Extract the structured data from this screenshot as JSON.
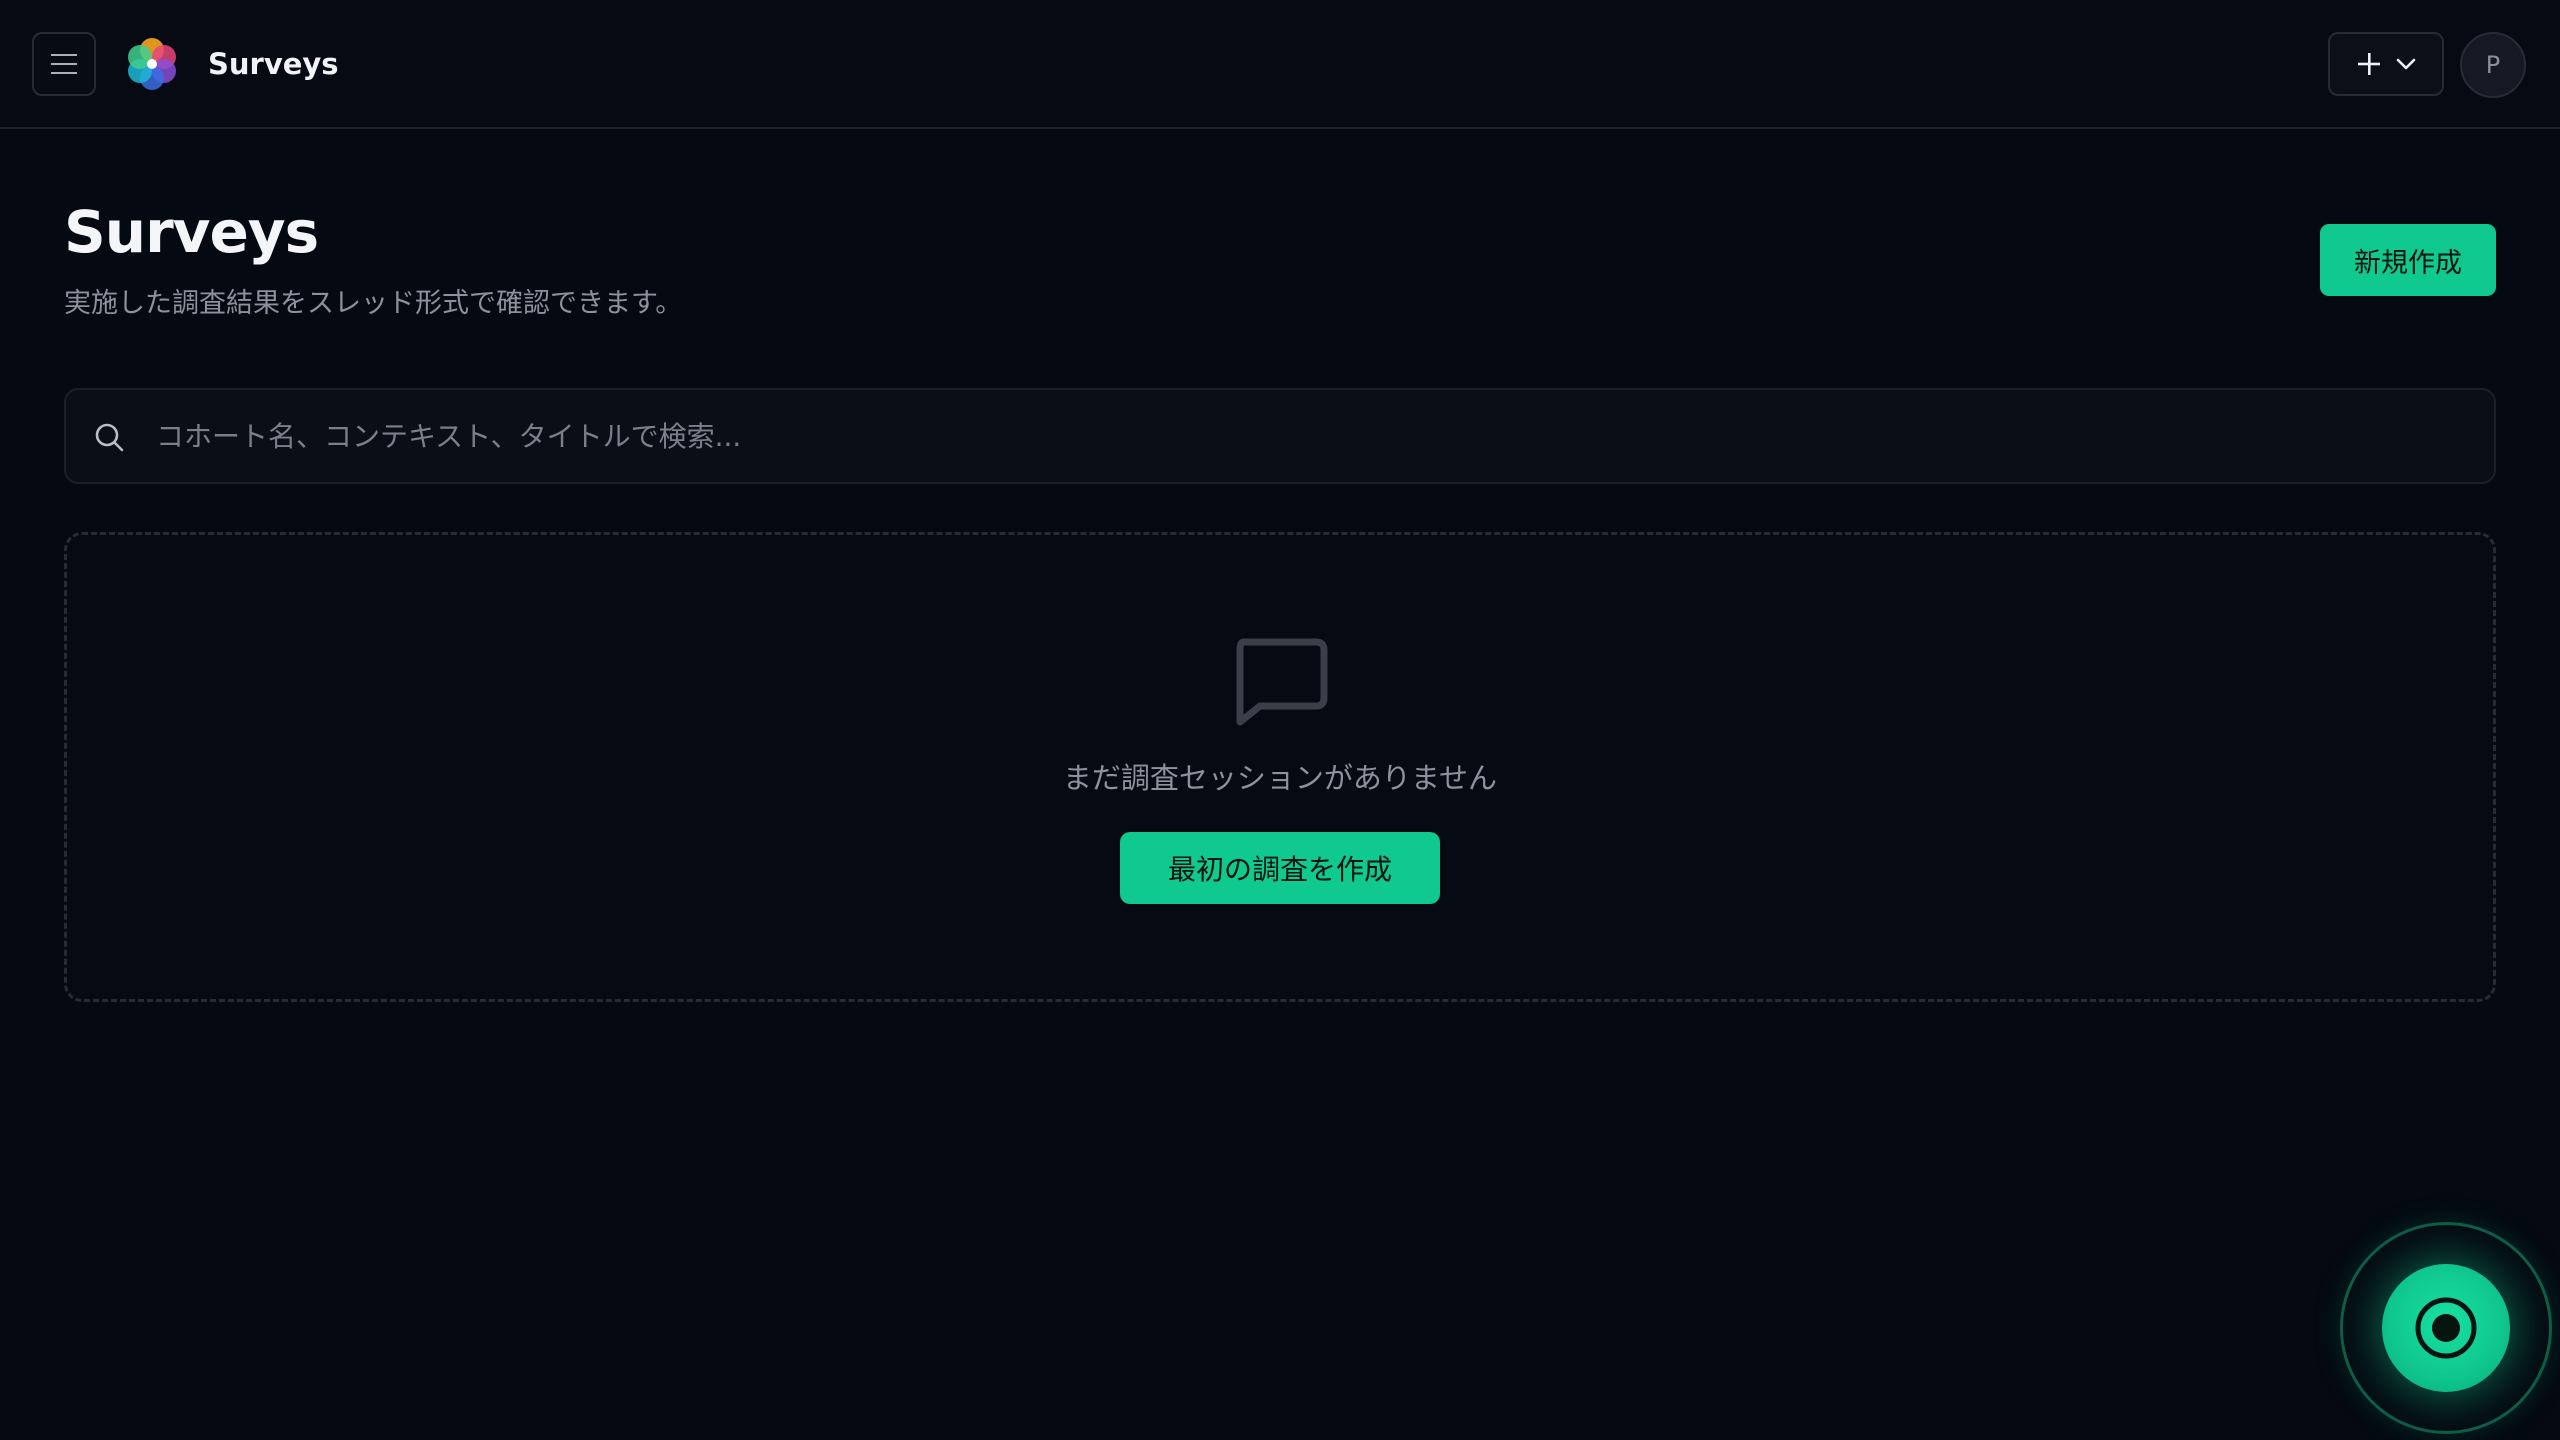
{
  "header": {
    "app_title": "Surveys",
    "menu_icon": "hamburger-icon",
    "logo_icon": "flower-logo",
    "add_icon": "plus-icon",
    "dropdown_icon": "chevron-down-icon",
    "avatar_initial": "P"
  },
  "page": {
    "title": "Surveys",
    "subtitle": "実施した調査結果をスレッド形式で確認できます。",
    "new_button_label": "新規作成"
  },
  "search": {
    "placeholder": "コホート名、コンテキスト、タイトルで検索...",
    "value": "",
    "icon": "search-icon"
  },
  "empty_state": {
    "icon": "chat-bubble-icon",
    "message": "まだ調査セッションがありません",
    "button_label": "最初の調査を作成"
  },
  "fab": {
    "icon": "record-icon"
  },
  "colors": {
    "background": "#050912",
    "accent": "#10c98f",
    "border": "#262c36",
    "muted_text": "#8c929d"
  }
}
